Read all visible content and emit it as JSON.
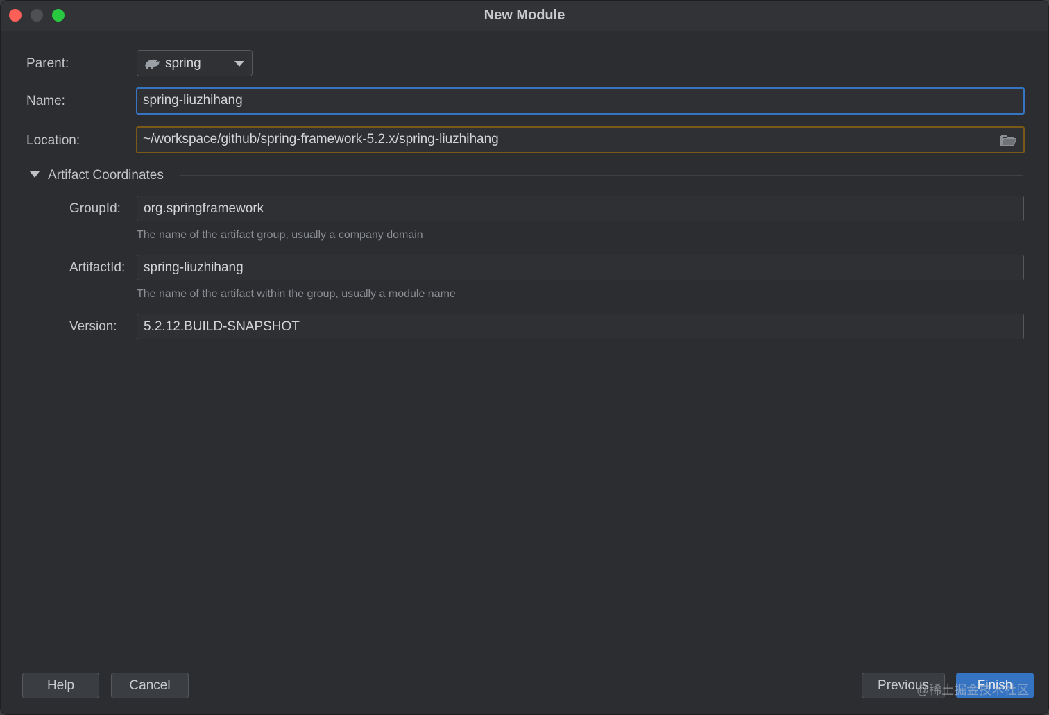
{
  "window": {
    "title": "New Module"
  },
  "parent": {
    "label": "Parent:",
    "value": "spring",
    "icon": "maven-module-icon"
  },
  "name": {
    "label": "Name:",
    "value": "spring-liuzhihang"
  },
  "location": {
    "label": "Location:",
    "value": "~/workspace/github/spring-framework-5.2.x/spring-liuzhihang",
    "icon": "folder-icon"
  },
  "artifact": {
    "section_title": "Artifact Coordinates",
    "group_id": {
      "label": "GroupId:",
      "value": "org.springframework",
      "hint": "The name of the artifact group, usually a company domain"
    },
    "artifact_id": {
      "label": "ArtifactId:",
      "value": "spring-liuzhihang",
      "hint": "The name of the artifact within the group, usually a module name"
    },
    "version": {
      "label": "Version:",
      "value": "5.2.12.BUILD-SNAPSHOT"
    }
  },
  "buttons": {
    "help": "Help",
    "cancel": "Cancel",
    "previous": "Previous",
    "finish": "Finish"
  },
  "watermark": "@稀土掘金技术社区",
  "colors": {
    "accent": "#3574c3",
    "warning_border": "#7b5a17",
    "background": "#2b2d30"
  }
}
